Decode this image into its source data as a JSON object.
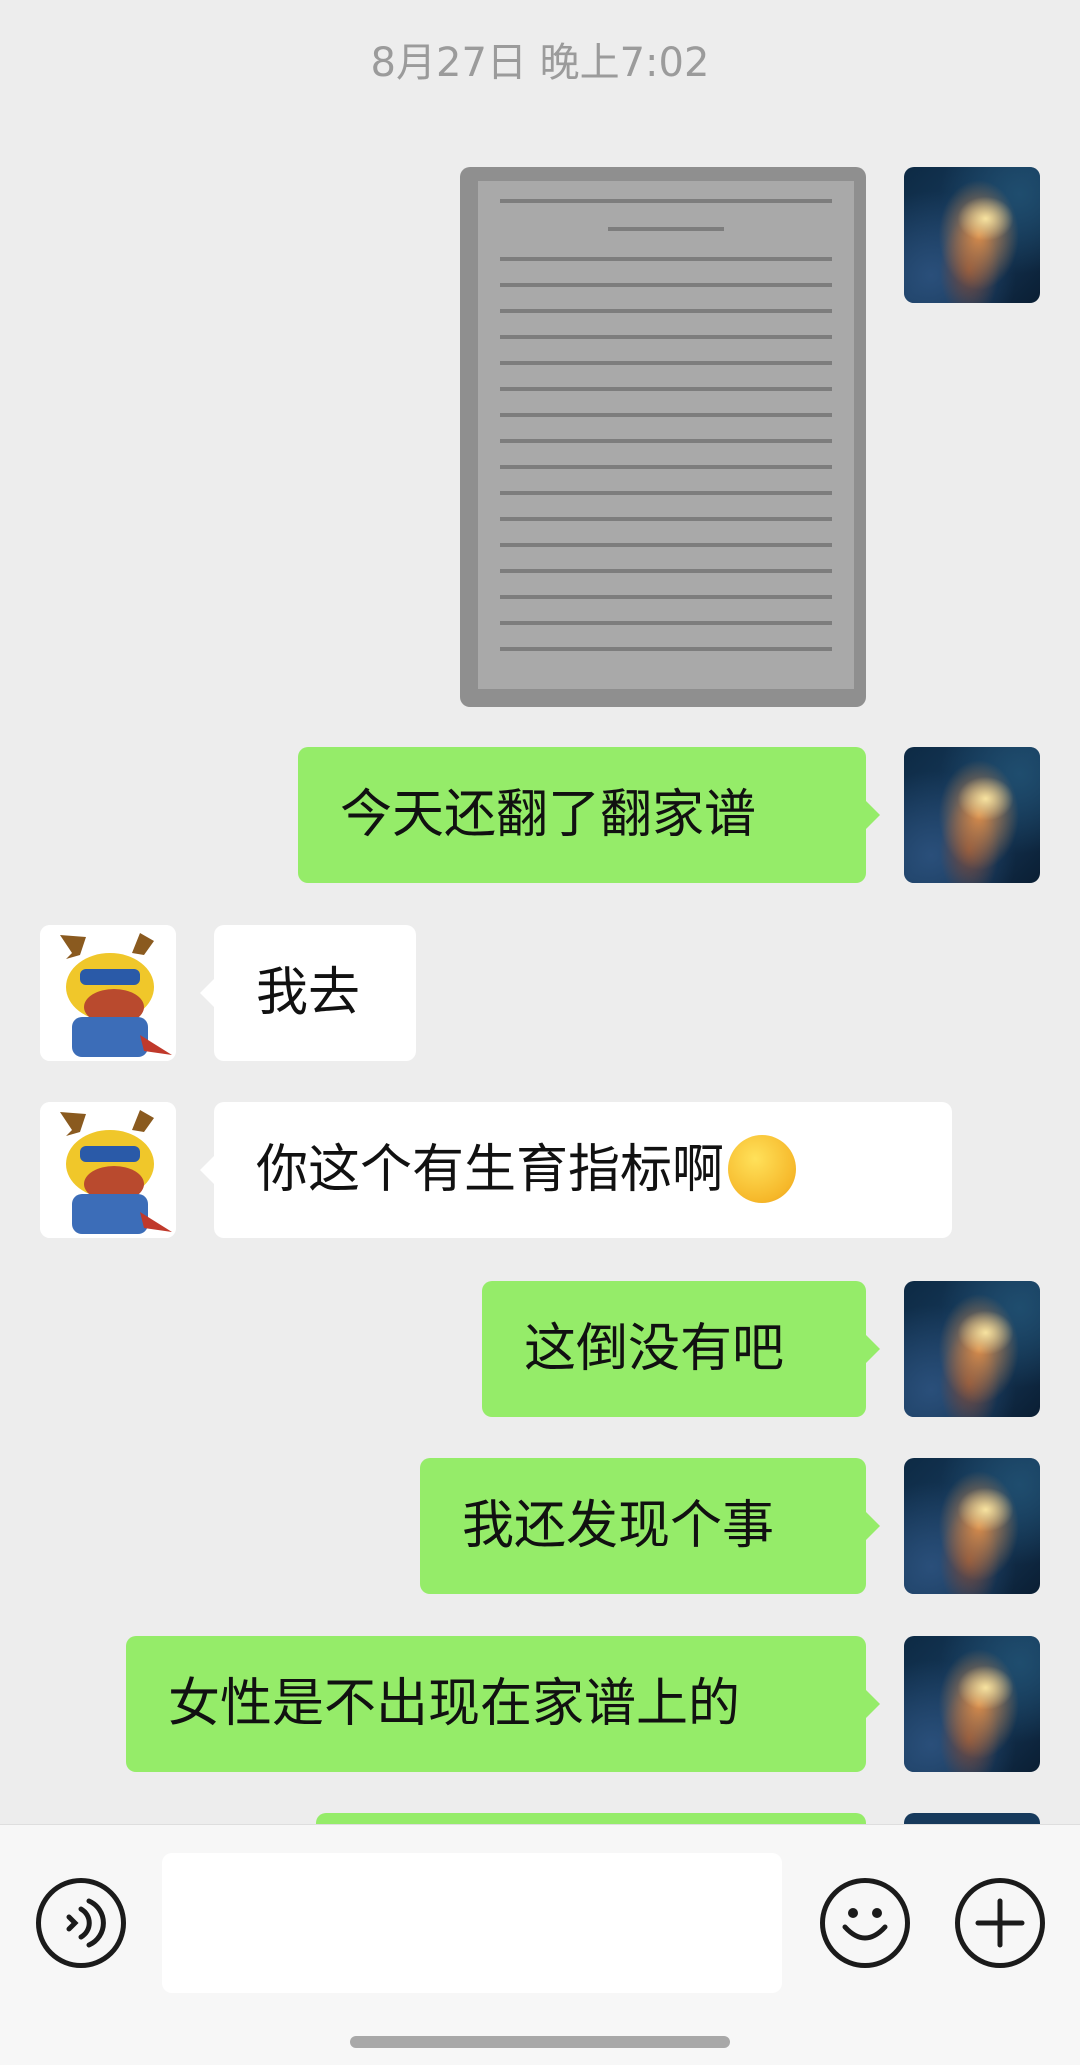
{
  "timestamp": "8月27日 晚上7:02",
  "messages": [
    {
      "from": "self",
      "type": "image"
    },
    {
      "from": "self",
      "type": "text",
      "text": "今天还翻了翻家谱"
    },
    {
      "from": "other",
      "type": "text",
      "text": "我去"
    },
    {
      "from": "other",
      "type": "text",
      "text": "你这个有生育指标啊",
      "emoji": "thinking-face"
    },
    {
      "from": "self",
      "type": "text",
      "text": "这倒没有吧"
    },
    {
      "from": "self",
      "type": "text",
      "text": "我还发现个事"
    },
    {
      "from": "self",
      "type": "text",
      "text": "女性是不出现在家谱上的"
    }
  ],
  "input": {
    "voice_icon": "voice-icon",
    "emoji_icon": "emoji-icon",
    "plus_icon": "plus-icon"
  },
  "colors": {
    "background": "#ededed",
    "self_bubble": "#95ec69",
    "other_bubble": "#ffffff"
  }
}
